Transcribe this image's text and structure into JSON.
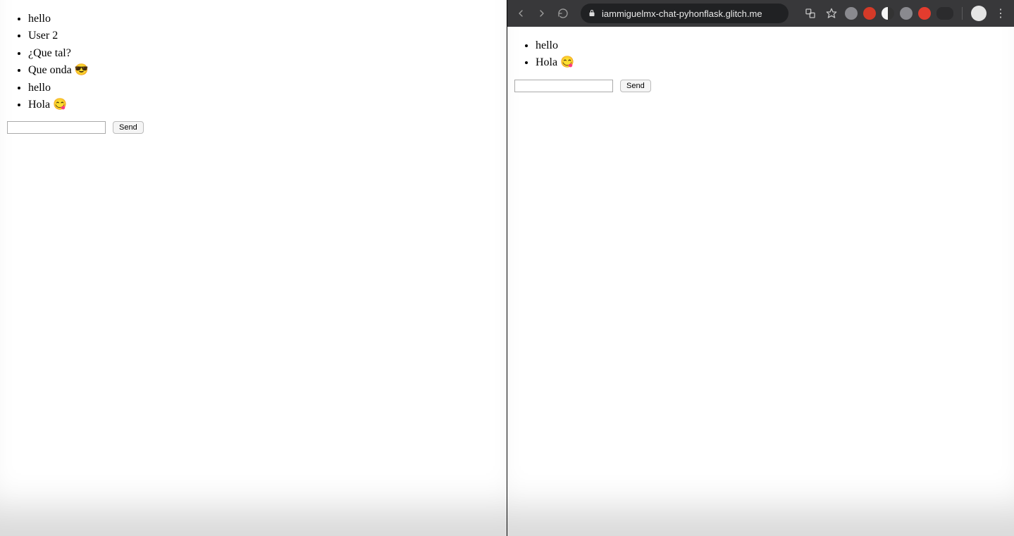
{
  "left_pane": {
    "messages": [
      "hello",
      "User 2",
      "¿Que tal?",
      "Que onda 😎",
      "hello",
      "Hola 😋"
    ],
    "input_value": "",
    "send_label": "Send"
  },
  "right_pane": {
    "browser": {
      "url": "iammiguelmx-chat-pyhonflask.glitch.me"
    },
    "messages": [
      "hello",
      "Hola 😋"
    ],
    "input_value": "",
    "send_label": "Send"
  }
}
